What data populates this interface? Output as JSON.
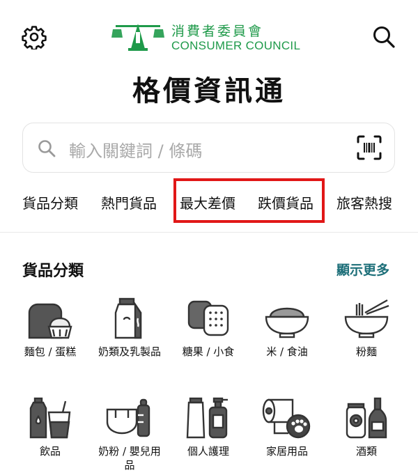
{
  "header": {
    "logo_chinese": "消費者委員會",
    "logo_english": "CONSUMER COUNCIL",
    "app_title": "格價資訊通"
  },
  "search": {
    "placeholder": "輸入關鍵詞 / 條碼"
  },
  "tabs": [
    "貨品分類",
    "熱門貨品",
    "最大差價",
    "跌價貨品",
    "旅客熱搜"
  ],
  "categories_section": {
    "title": "貨品分類",
    "more_label": "顯示更多",
    "items": [
      {
        "label": "麵包 / 蛋糕",
        "icon": "bread-cake-icon"
      },
      {
        "label": "奶類及乳製品",
        "icon": "milk-carton-icon"
      },
      {
        "label": "糖果 / 小食",
        "icon": "biscuits-icon"
      },
      {
        "label": "米 / 食油",
        "icon": "rice-bowl-icon"
      },
      {
        "label": "粉麵",
        "icon": "noodle-bowl-icon"
      },
      {
        "label": "飲品",
        "icon": "drinks-icon"
      },
      {
        "label": "奶粉 / 嬰兒用品",
        "icon": "baby-products-icon"
      },
      {
        "label": "個人護理",
        "icon": "personal-care-icon"
      },
      {
        "label": "家居用品",
        "icon": "household-icon"
      },
      {
        "label": "酒類",
        "icon": "alcohol-icon"
      }
    ]
  },
  "colors": {
    "brand_green": "#1f9a4a",
    "link_teal": "#1d6f79",
    "highlight_red": "#e11717"
  }
}
